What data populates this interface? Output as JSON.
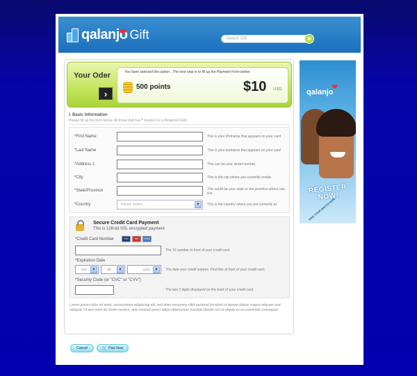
{
  "header": {
    "logo_text": "qalanjo",
    "logo_suffix": "Gift",
    "search_placeholder": "Search Gift"
  },
  "order": {
    "title": "Your Oder",
    "note": "You have selected this option . The next step is to fill up the Payment Form below:",
    "points": "500 points",
    "price": "$10",
    "currency": "USD"
  },
  "section": {
    "title": "I. Basic Information",
    "subtitle_before": "Please fill up the form below. All those that has ",
    "subtitle_ast": "*",
    "subtitle_after": " means it is a Required Field"
  },
  "fields": [
    {
      "label": "First Name",
      "hint": "This is your firstname that appears on your card"
    },
    {
      "label": "Last Name",
      "hint": "This is your lastname that appears on your card"
    },
    {
      "label": "Address 1",
      "hint": "This can be your street number."
    },
    {
      "label": "City",
      "hint": "This is the city where you currently reside."
    },
    {
      "label": "State/Province",
      "hint": "This could be your state or the province where you live."
    },
    {
      "label": "Country",
      "hint": "This is the country where you are currently at.",
      "placeholder": "Please Select..."
    }
  ],
  "credit_card": {
    "title": "Secure Credit Card Payment",
    "subtitle": "This is 128-bit SSL encrypted payment",
    "number_label": "Credit Card Number",
    "number_hint": "The 16 number in front of your credit card",
    "card_brands": [
      "VISA",
      "MC",
      "AMEX"
    ],
    "expiration_label": "Expiration Date",
    "month_placeholder": "mm",
    "day_placeholder": "dd",
    "year_placeholder": "yyyy",
    "expiration_hint": "The date your credit expires. Find this at front of your credit card.",
    "security_label": "Security Code (or \"CVC\" or \"CVV\")",
    "security_hint": "The last 3 digits displayed on the back of your credit card."
  },
  "lorem": "Lorem ipsum dolor sit amet, consectetuer adipiscing elit, sed diam nonummy nibh euismod tincidunt ut laoreet dolore magna aliquam erat volutpat. Ut wisi enim ad minim veniam, quis nostrud exerci tation ullamcorper suscipit lobortis nisl ut aliquip ex ea commodo consequat.",
  "buttons": {
    "cancel": "Cancel",
    "pay": "Paw Now"
  },
  "ad": {
    "logo": "qalanjo",
    "cta": "REGISTER NOW!",
    "small": "FIND YOUR MATCH NOW"
  },
  "colors": {
    "background": "#0000b0",
    "header": "#1b6fbd",
    "order_green": "#c3e45a",
    "button_cyan": "#8fdcf0"
  }
}
